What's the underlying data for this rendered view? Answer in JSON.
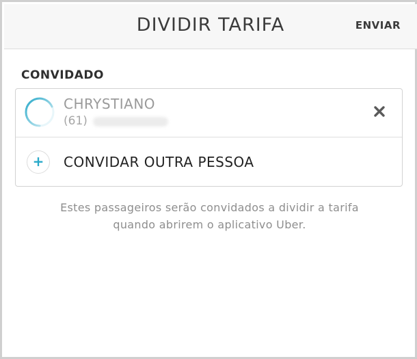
{
  "header": {
    "title": "DIVIDIR TARIFA",
    "send_label": "ENVIAR"
  },
  "section": {
    "label": "CONVIDADO"
  },
  "guest": {
    "name": "CHRYSTIANO",
    "phone_prefix": "(61)",
    "status_icon": "loading-spinner-icon",
    "remove_icon": "close-icon"
  },
  "invite": {
    "icon": "plus-icon",
    "label": "CONVIDAR OUTRA PESSOA"
  },
  "info": {
    "line1": "Estes passageiros serão convidados a dividir a tarifa",
    "line2": "quando abrirem o aplicativo Uber."
  },
  "colors": {
    "accent": "#29a9c9",
    "header_bg": "#f7f7f7",
    "text_dark": "#3b3b3b",
    "text_muted": "#9a9a9a"
  }
}
